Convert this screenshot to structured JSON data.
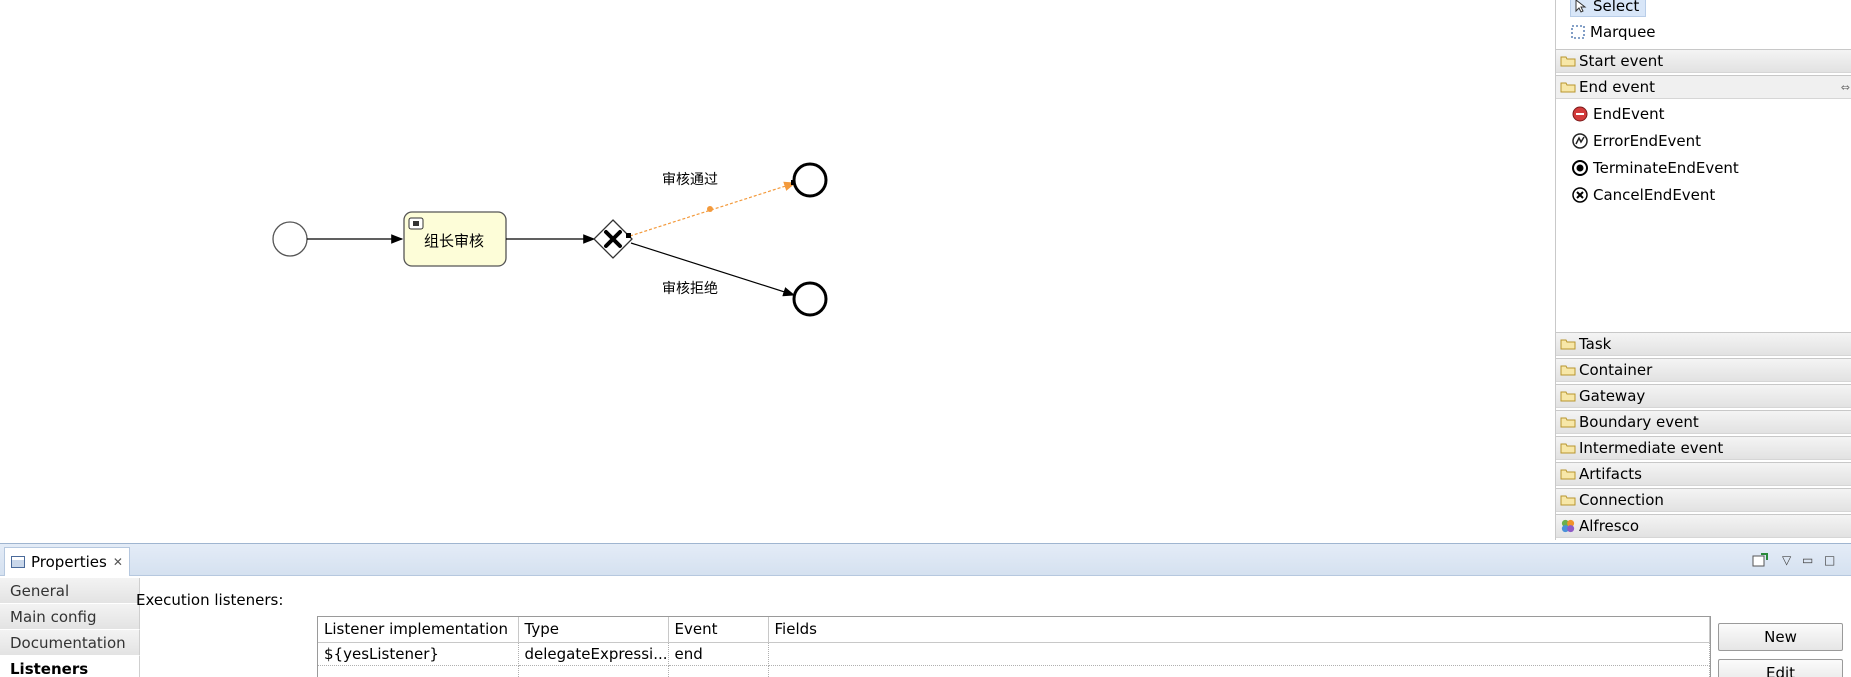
{
  "canvas": {
    "task_label": "组长审核",
    "flow_yes_label": "审核通过",
    "flow_no_label": "审核拒绝"
  },
  "palette": {
    "tools": [
      {
        "label": "Select",
        "icon": "arrow-cursor-icon"
      },
      {
        "label": "Marquee",
        "icon": "marquee-icon"
      }
    ],
    "drawers_top": [
      {
        "label": "Start event",
        "state": "collapsed"
      },
      {
        "label": "End event",
        "state": "open"
      }
    ],
    "end_event_entries": [
      {
        "label": "EndEvent",
        "icon": "end-event-icon"
      },
      {
        "label": "ErrorEndEvent",
        "icon": "error-end-event-icon"
      },
      {
        "label": "TerminateEndEvent",
        "icon": "terminate-end-event-icon"
      },
      {
        "label": "CancelEndEvent",
        "icon": "cancel-end-event-icon"
      }
    ],
    "drawers_bottom": [
      {
        "label": "Task"
      },
      {
        "label": "Container"
      },
      {
        "label": "Gateway"
      },
      {
        "label": "Boundary event"
      },
      {
        "label": "Intermediate event"
      },
      {
        "label": "Artifacts"
      },
      {
        "label": "Connection"
      },
      {
        "label": "Alfresco"
      }
    ]
  },
  "properties": {
    "tab_title": "Properties",
    "side_tabs": [
      "General",
      "Main config",
      "Documentation",
      "Listeners"
    ],
    "active_side_tab": "Listeners",
    "section_label": "Execution listeners:",
    "table": {
      "headers": [
        "Listener implementation",
        "Type",
        "Event",
        "Fields"
      ],
      "rows": [
        [
          "${yesListener}",
          "delegateExpressi...",
          "end",
          ""
        ]
      ]
    },
    "buttons": {
      "new": "New",
      "edit": "Edit"
    }
  },
  "colors": {
    "task_fill": "#fdfdd8",
    "selected_flow": "#f39a3c",
    "end_event_red": "#d33b3b",
    "header_blue": "#d9e4f2"
  }
}
